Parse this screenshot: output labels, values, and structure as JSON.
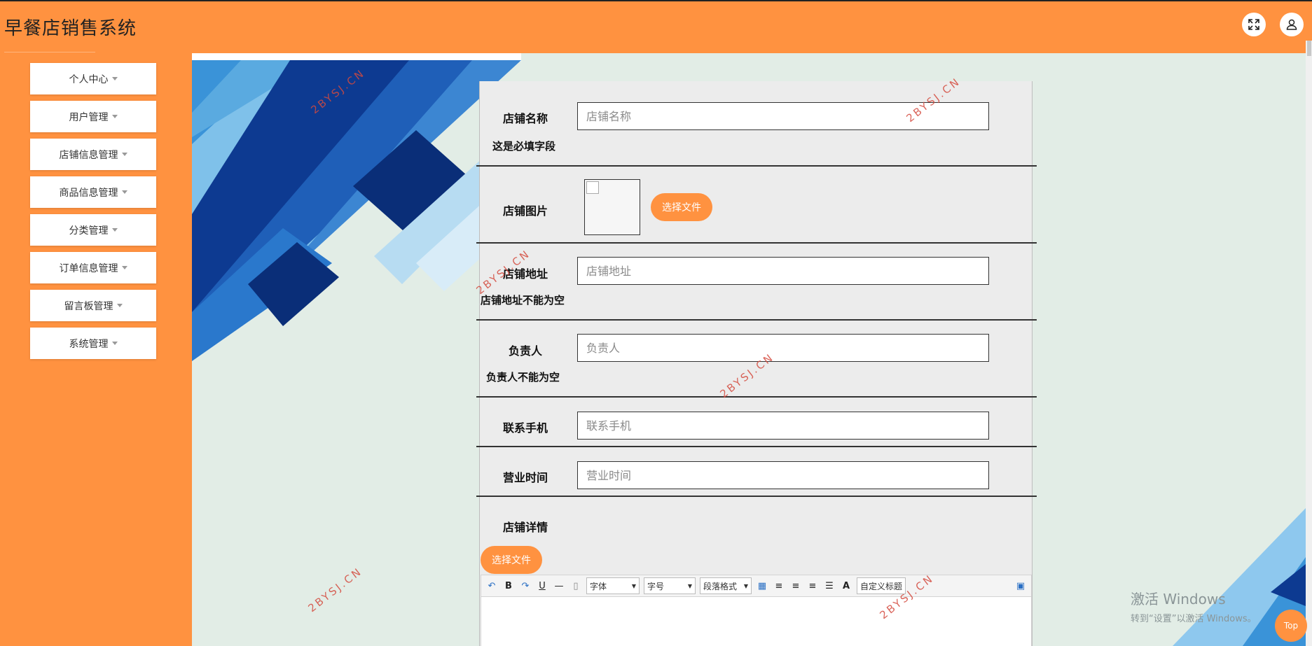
{
  "app": {
    "title": "早餐店销售系统"
  },
  "header": {
    "fullscreen_icon": "expand-icon",
    "user_icon": "user-icon"
  },
  "sidebar": {
    "items": [
      {
        "label": "个人中心"
      },
      {
        "label": "用户管理"
      },
      {
        "label": "店铺信息管理"
      },
      {
        "label": "商品信息管理"
      },
      {
        "label": "分类管理"
      },
      {
        "label": "订单信息管理"
      },
      {
        "label": "留言板管理"
      },
      {
        "label": "系统管理"
      }
    ]
  },
  "form": {
    "shop_name": {
      "label": "店铺名称",
      "placeholder": "店铺名称",
      "value": "",
      "error": "这是必填字段"
    },
    "shop_image": {
      "label": "店铺图片",
      "button": "选择文件"
    },
    "shop_address": {
      "label": "店铺地址",
      "placeholder": "店铺地址",
      "value": "",
      "error": "店铺地址不能为空"
    },
    "owner": {
      "label": "负责人",
      "placeholder": "负责人",
      "value": "",
      "error": "负责人不能为空"
    },
    "phone": {
      "label": "联系手机",
      "placeholder": "联系手机",
      "value": ""
    },
    "hours": {
      "label": "营业时间",
      "placeholder": "营业时间",
      "value": ""
    },
    "details": {
      "label": "店铺详情",
      "button": "选择文件"
    }
  },
  "editor": {
    "font_select": "字体",
    "size_select": "字号",
    "paragraph_select": "段落格式",
    "custom_title_select": "自定义标题",
    "bold": "B",
    "underline": "U",
    "font_color": "A"
  },
  "watermark": {
    "text": "2BYSJ.CN"
  },
  "windows_activation": {
    "line1": "激活 Windows",
    "line2": "转到“设置”以激活 Windows。"
  },
  "top_button": {
    "label": "Top"
  },
  "colors": {
    "accent": "#ff9240",
    "main_bg": "#e2ede6",
    "form_bg": "#ececec",
    "deco_dark": "#0d3a91",
    "deco_mid": "#2f8fd6",
    "deco_light": "#8ec8ee"
  }
}
